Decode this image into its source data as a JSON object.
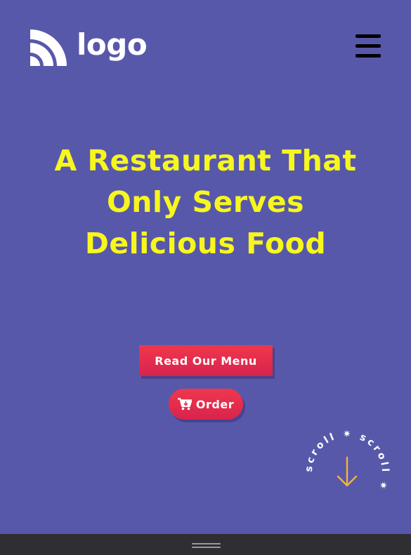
{
  "header": {
    "logo_text": "logo",
    "logo_icon": "wifi-arcs-logo-icon",
    "menu_icon": "hamburger-menu-icon"
  },
  "hero": {
    "title": "A Restaurant That Only Serves Delicious Food"
  },
  "actions": {
    "read_menu_label": "Read Our Menu",
    "order_label": "Order",
    "order_icon": "cart-icon"
  },
  "scroll_badge": {
    "text": "scroll ✷ scroll ✷ ",
    "arrow_icon": "arrow-down-icon"
  },
  "bottom_bar": {
    "handle_icon": "drag-handle-icon"
  },
  "colors": {
    "background": "#5858ab",
    "title": "#f7f71d",
    "button": "#e22f4d",
    "arrow": "#f2b43c",
    "bottom_bar": "#2f2f33"
  }
}
